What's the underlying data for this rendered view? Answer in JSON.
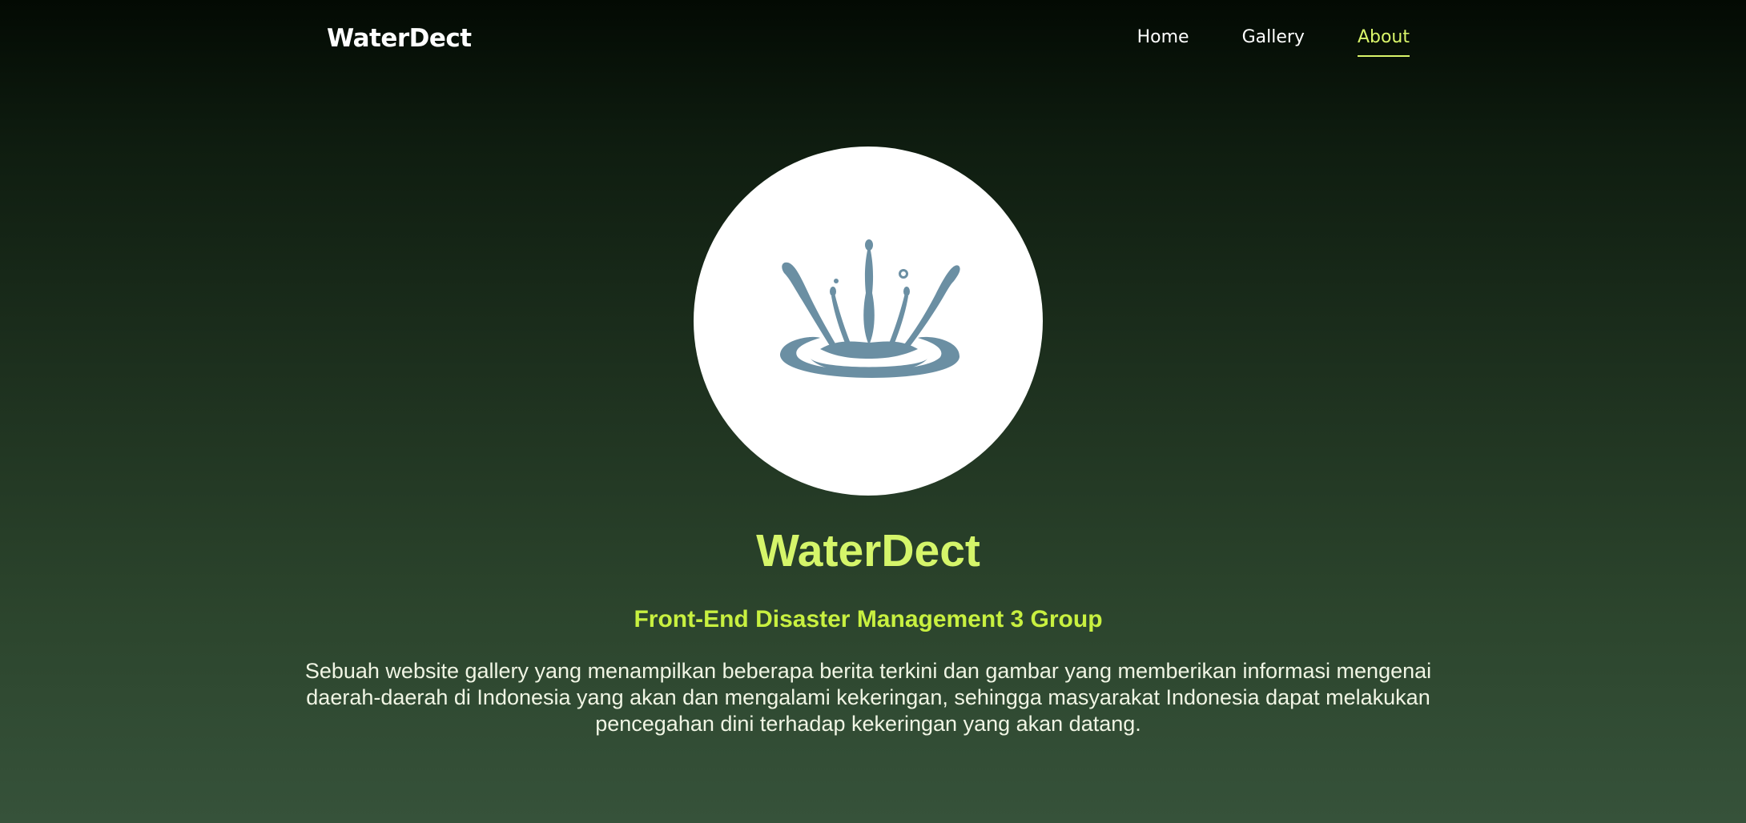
{
  "nav": {
    "brand": "WaterDect",
    "links": [
      {
        "label": "Home"
      },
      {
        "label": "Gallery"
      },
      {
        "label": "About"
      }
    ]
  },
  "hero": {
    "logo_icon": "water-splash-icon",
    "title": "WaterDect",
    "subtitle": "Front-End Disaster Management 3 Group",
    "description": "Sebuah website gallery yang menampilkan beberapa berita terkini dan gambar yang memberikan informasi mengenai daerah-daerah di Indonesia yang akan dan mengalami kekeringan, sehingga masyarakat Indonesia dapat melakukan pencegahan dini terhadap kekeringan yang akan datang."
  },
  "colors": {
    "accent": "#d5f56a",
    "subtitle": "#c8f040",
    "logo": "#6b8fa3",
    "background_top": "#030a03",
    "background_bottom": "#36523a"
  }
}
